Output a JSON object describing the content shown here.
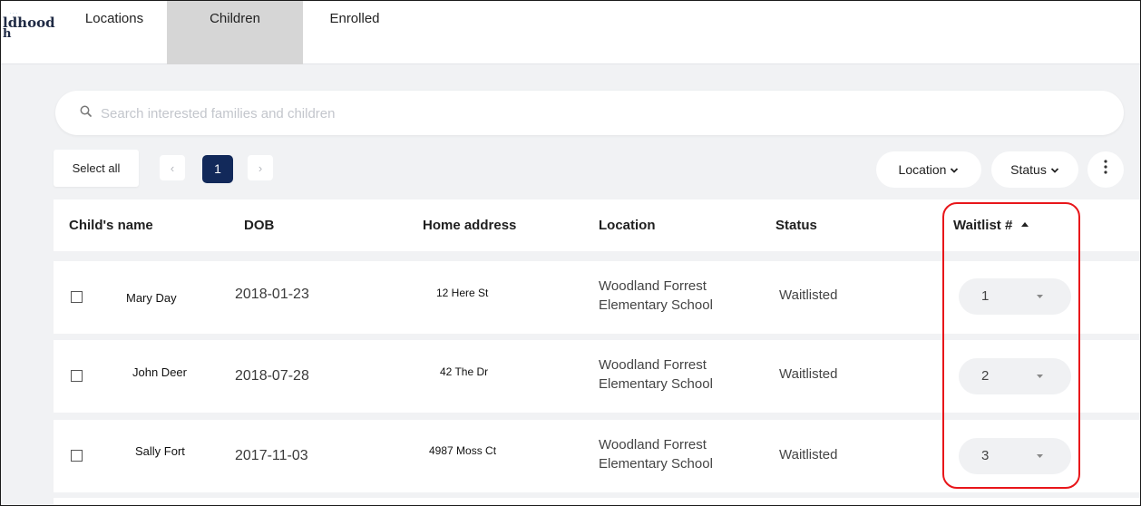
{
  "nav": {
    "logo_line1": "ldhood",
    "logo_line2": "h",
    "logo_tiny": "· · ·",
    "tabs": [
      "Locations",
      "Children",
      "Enrolled"
    ],
    "active_tab": "Children"
  },
  "search": {
    "placeholder": "Search interested families and children",
    "value": ""
  },
  "toolbar": {
    "select_all": "Select all",
    "prev": "‹",
    "page": "1",
    "next": "›",
    "filter_location": "Location",
    "filter_status": "Status",
    "more": "⋮"
  },
  "table": {
    "headers": {
      "name": "Child's name",
      "dob": "DOB",
      "address": "Home address",
      "location": "Location",
      "status": "Status",
      "waitlist": "Waitlist #"
    },
    "rows": [
      {
        "name": "Mary Day",
        "dob": "2018-01-23",
        "address": "12 Here St",
        "location_line1": "Woodland Forrest",
        "location_line2": "Elementary School",
        "status": "Waitlisted",
        "waitlist": "1"
      },
      {
        "name": "John Deer",
        "dob": "2018-07-28",
        "address": "42 The Dr",
        "location_line1": "Woodland Forrest",
        "location_line2": "Elementary School",
        "status": "Waitlisted",
        "waitlist": "2"
      },
      {
        "name": "Sally Fort",
        "dob": "2017-11-03",
        "address": "4987 Moss Ct",
        "location_line1": "Woodland Forrest",
        "location_line2": "Elementary School",
        "status": "Waitlisted",
        "waitlist": "3"
      }
    ]
  },
  "colors": {
    "accent": "#12295a",
    "highlight": "#e8161a",
    "background": "#f1f2f4"
  },
  "icons": {
    "search": "search-icon",
    "chevron": "chevron-down-icon",
    "sort": "sort-ascending-icon",
    "more": "more-vertical-icon"
  }
}
